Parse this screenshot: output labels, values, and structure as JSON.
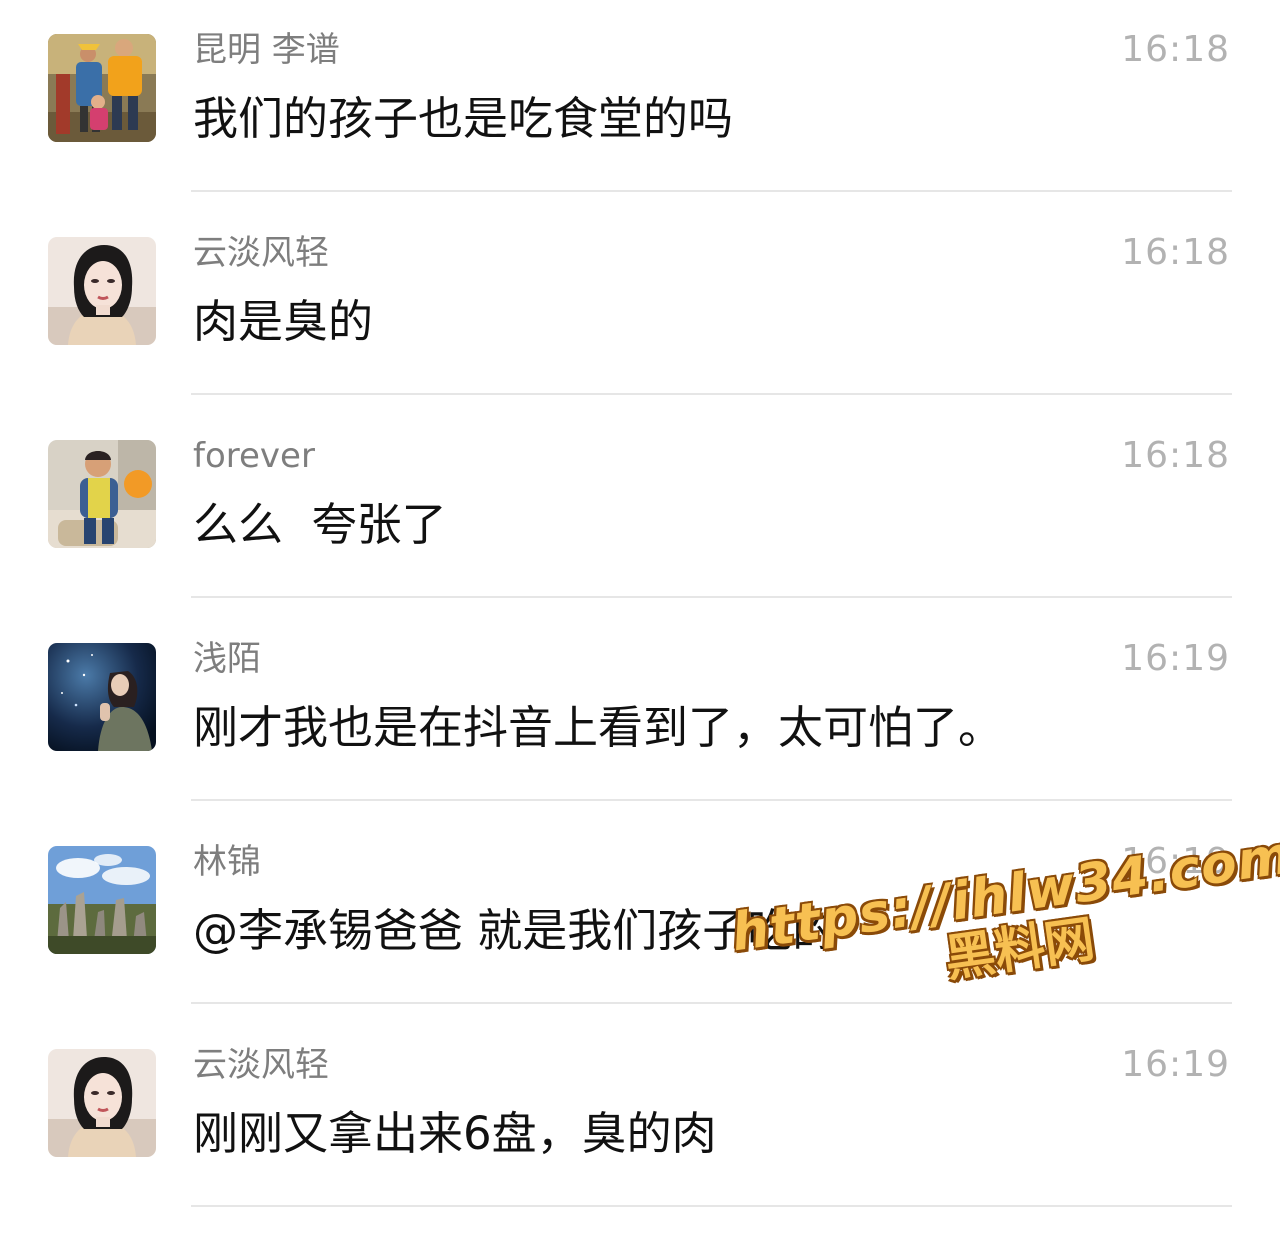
{
  "messages": [
    {
      "name": "昆明 李谱",
      "time": "16:18",
      "text": "我们的孩子也是吃食堂的吗",
      "avatar": "family-photo"
    },
    {
      "name": "云淡风轻",
      "time": "16:18",
      "text": "肉是臭的",
      "avatar": "woman-portrait"
    },
    {
      "name": "forever",
      "time": "16:18",
      "text": "么么  夸张了",
      "avatar": "child-with-balloon"
    },
    {
      "name": "浅陌",
      "time": "16:19",
      "text": "刚才我也是在抖音上看到了，太可怕了。",
      "avatar": "starry-sky-girl"
    },
    {
      "name": "林锦",
      "time": "16:19",
      "text": "@李承锡爸爸 就是我们孩子吃的",
      "avatar": "stone-forest-landscape"
    },
    {
      "name": "云淡风轻",
      "time": "16:19",
      "text": "刚刚又拿出来6盘，臭的肉",
      "avatar": "woman-portrait"
    }
  ],
  "watermark": {
    "url": "https://ihlw34.com",
    "label": "黑料网"
  }
}
